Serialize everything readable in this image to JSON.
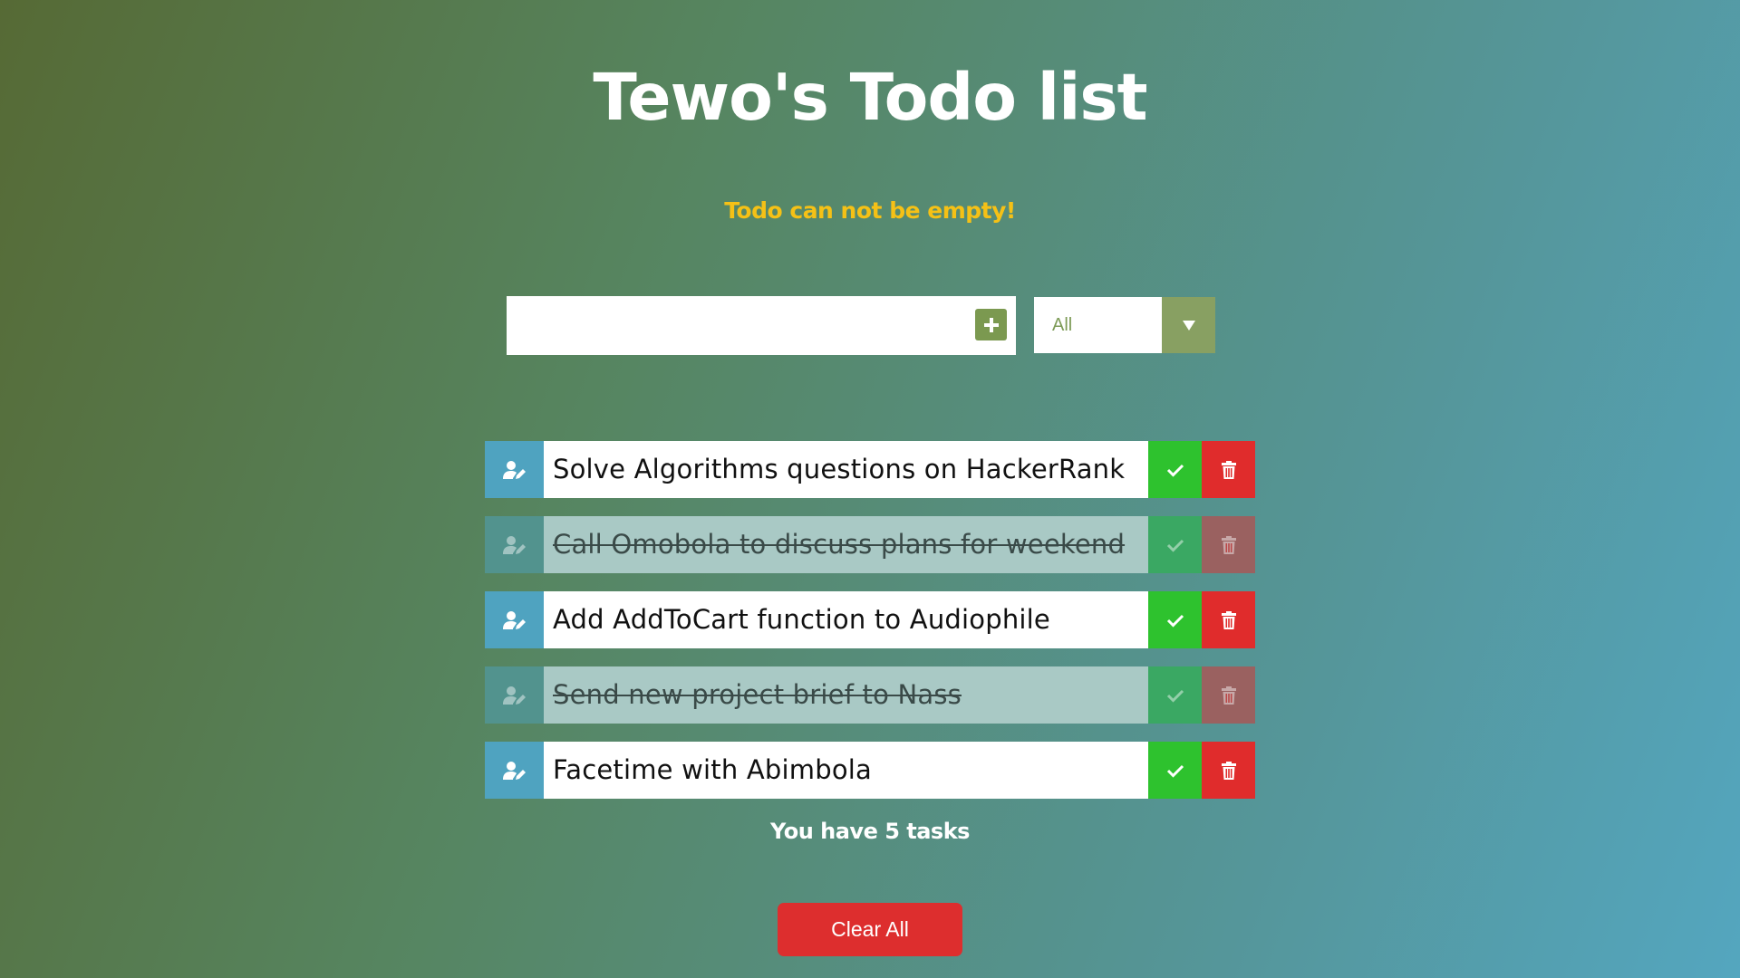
{
  "header": {
    "title": "Tewo's Todo list"
  },
  "alert": {
    "message": "Todo can not be empty!",
    "color": "#f5c116"
  },
  "new_todo": {
    "value": "",
    "placeholder": "",
    "add_icon": "plus-icon"
  },
  "filter": {
    "selected": "All",
    "arrow_icon": "caret-down-icon"
  },
  "todos": [
    {
      "text": "Solve Algorithms questions on HackerRank",
      "completed": false
    },
    {
      "text": "Call Omobola to discuss plans for weekend",
      "completed": true
    },
    {
      "text": "Add AddToCart function to Audiophile",
      "completed": false
    },
    {
      "text": "Send new project brief to Nass",
      "completed": true
    },
    {
      "text": "Facetime with Abimbola",
      "completed": false
    }
  ],
  "icons": {
    "edit": "user-edit-icon",
    "complete": "check-icon",
    "delete": "trash-icon"
  },
  "footer": {
    "count_text": "You have 5 tasks",
    "clear_label": "Clear All"
  },
  "colors": {
    "edit_bg": "#4fa3c0",
    "complete_bg": "#2ec22e",
    "delete_bg": "#e02c2c",
    "accent": "#7b9950"
  }
}
